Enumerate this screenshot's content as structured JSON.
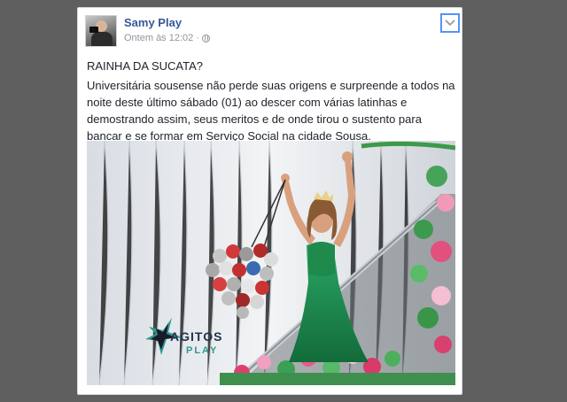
{
  "post": {
    "author": "Samy Play",
    "timestamp": "Ontem às 12:02",
    "separator": "·",
    "privacy_icon": "globe-icon",
    "options_icon": "chevron-down-icon",
    "title": "RAINHA DA SUCATA?",
    "body": "Universitária sousense não perde suas origens e surpreende a todos na noite deste último sábado (01) ao descer com várias latinhas e demostrando assim, seus meritos e de onde tirou o sustento para bancar e se formar em Serviço Social na cidade Sousa.",
    "photo": {
      "watermark_main": "AGITOS",
      "watermark_sub": "PLAY"
    }
  },
  "colors": {
    "page_background": "#5f5f5f",
    "author_link": "#365899",
    "meta_text": "#90949c",
    "focus_outline": "#5890ff",
    "dress_green": "#1f8f4f"
  }
}
